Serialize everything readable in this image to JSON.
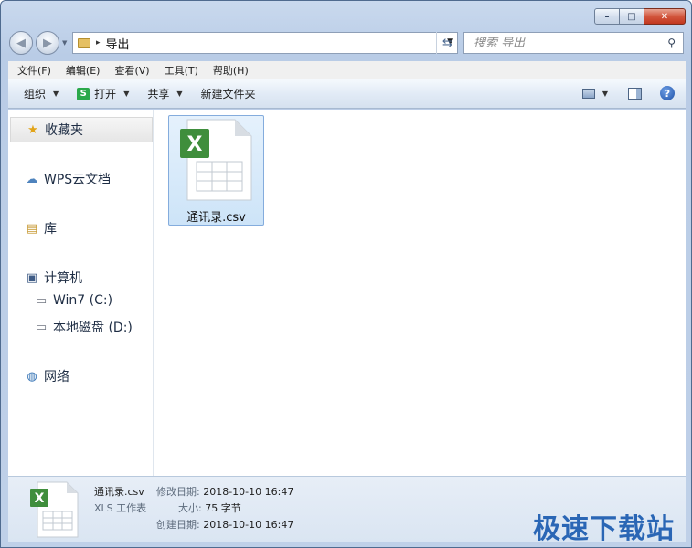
{
  "window": {
    "caption": {
      "minimize": "–",
      "maximize": "□",
      "close": "✕"
    }
  },
  "address": {
    "back": "◀",
    "forward": "▶",
    "separator": "▸",
    "crumb": "导出",
    "refresh": "⇆"
  },
  "search": {
    "placeholder": "搜索 导出"
  },
  "menu": {
    "file": "文件(F)",
    "edit": "编辑(E)",
    "view": "查看(V)",
    "tools": "工具(T)",
    "help": "帮助(H)"
  },
  "toolbar": {
    "organize": "组织",
    "open": "打开",
    "share": "共享",
    "new_folder": "新建文件夹"
  },
  "sidebar": {
    "favorites": "收藏夹",
    "wps_cloud": "WPS云文档",
    "libraries": "库",
    "computer": "计算机",
    "drive_c": "Win7 (C:)",
    "drive_d": "本地磁盘 (D:)",
    "network": "网络"
  },
  "file": {
    "name": "通讯录.csv",
    "icon_letter": "X"
  },
  "details": {
    "name": "通讯录.csv",
    "type": "XLS 工作表",
    "modified_label": "修改日期:",
    "modified_value": "2018-10-10 16:47",
    "size_label": "大小:",
    "size_value": "75 字节",
    "created_label": "创建日期:",
    "created_value": "2018-10-10 16:47"
  },
  "watermark": "极速下载站",
  "colors": {
    "excel_green": "#3f8e3c",
    "accent_blue": "#2a66b5"
  }
}
